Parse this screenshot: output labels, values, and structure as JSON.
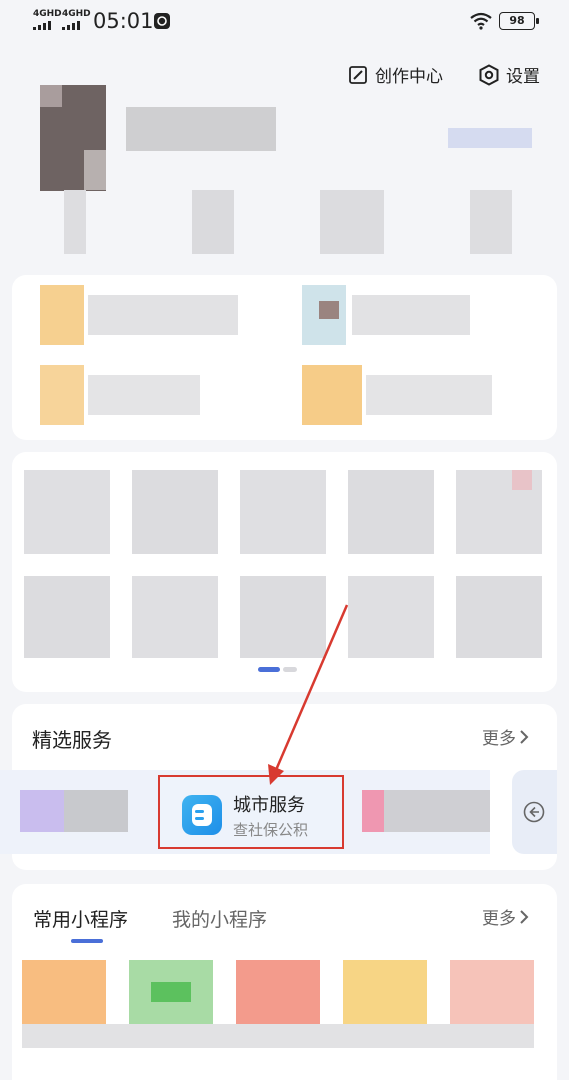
{
  "status_bar": {
    "signal_1": "4GHD",
    "signal_2": "4GHD",
    "time": "05:01",
    "battery": "98"
  },
  "header": {
    "creator_center": "创作中心",
    "settings": "设置"
  },
  "featured_services": {
    "title": "精选服务",
    "more": "更多",
    "highlighted_item": {
      "title": "城市服务",
      "subtitle": "查社保公积",
      "icon": "city-service-icon"
    }
  },
  "mini_programs": {
    "tab_common": "常用小程序",
    "tab_mine": "我的小程序",
    "more": "更多"
  },
  "colors": {
    "accent": "#4a6fd8",
    "annotation_red": "#d83a30",
    "background": "#f4f5f8"
  }
}
